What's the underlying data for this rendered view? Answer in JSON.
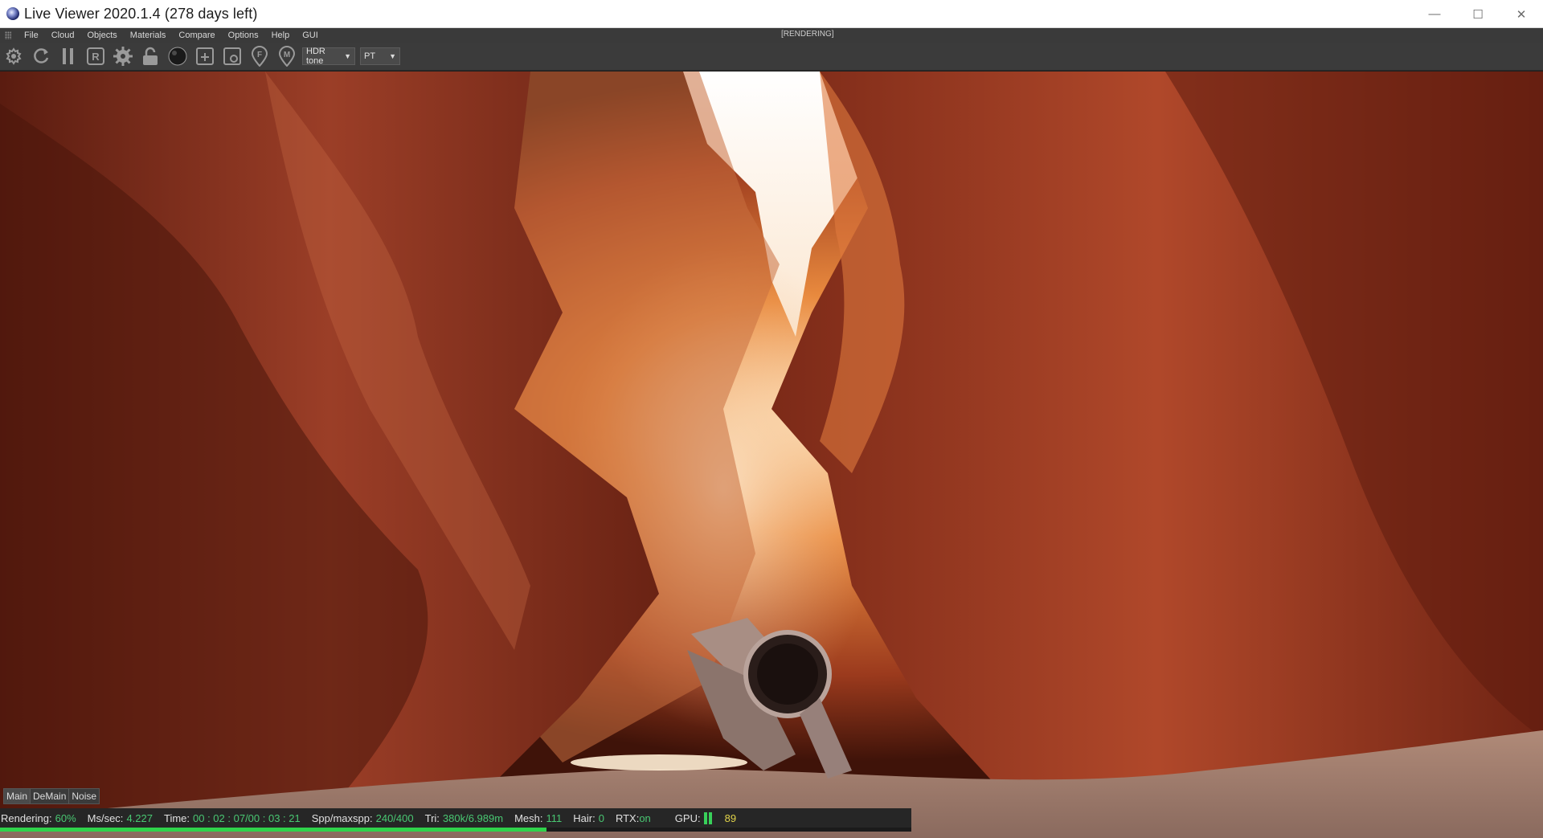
{
  "window": {
    "title": "Live Viewer 2020.1.4 (278 days left)",
    "controls": {
      "minimize": "—",
      "maximize": "☐",
      "close": "✕"
    }
  },
  "menu": {
    "items": [
      "File",
      "Cloud",
      "Objects",
      "Materials",
      "Compare",
      "Options",
      "Help",
      "GUI"
    ],
    "status": "[RENDERING]"
  },
  "toolbar": {
    "icons": [
      "settings-sync-icon",
      "refresh-icon",
      "pause-icon",
      "render-region-icon",
      "gear-icon",
      "lock-icon",
      "material-sphere-icon",
      "add-buffer-icon",
      "clay-mode-icon",
      "focus-picker-icon",
      "material-picker-icon"
    ],
    "labels": {
      "region": "R",
      "focus": "F",
      "material": "M"
    },
    "tonemap_select": "HDR tone",
    "kernel_select": "PT"
  },
  "buffers": {
    "tabs": [
      "Main",
      "DeMain",
      "Noise"
    ],
    "active": "Main"
  },
  "status": {
    "rendering_label": "Rendering:",
    "rendering_value": "60%",
    "progress": 0.6,
    "ms_label": "Ms/sec:",
    "ms_value": "4.227",
    "time_label": "Time:",
    "time_value": "00 : 02 : 07/00 : 03 : 21",
    "spp_label": "Spp/maxspp:",
    "spp_value": "240/400",
    "tri_label": "Tri:",
    "tri_value": "380k/6.989m",
    "mesh_label": "Mesh:",
    "mesh_value": "111",
    "hair_label": "Hair:",
    "hair_value": "0",
    "rtx_label": "RTX:",
    "rtx_value": "on",
    "gpu_label": "GPU:",
    "gpu_value": "89"
  },
  "colors": {
    "accent_green": "#49c772",
    "progress_green": "#2fd34b",
    "gpu_yellow": "#e2d44a"
  }
}
